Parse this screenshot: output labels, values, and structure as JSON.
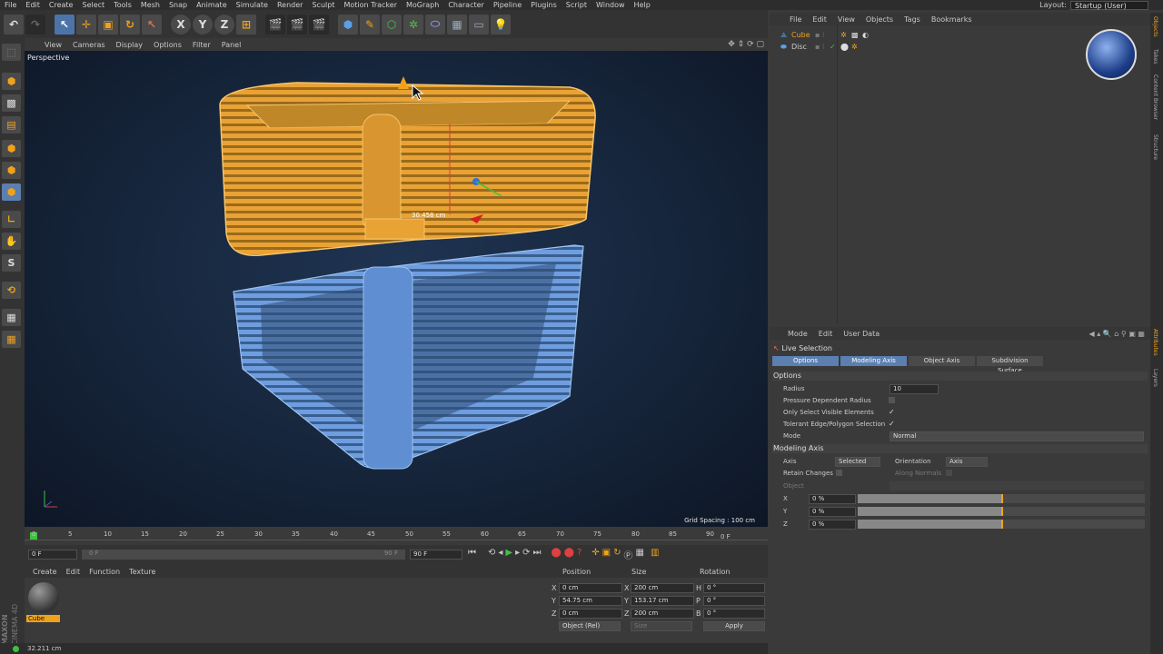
{
  "menubar": {
    "items": [
      "File",
      "Edit",
      "Create",
      "Select",
      "Tools",
      "Mesh",
      "Snap",
      "Animate",
      "Simulate",
      "Render",
      "Sculpt",
      "Motion Tracker",
      "MoGraph",
      "Character",
      "Pipeline",
      "Plugins",
      "Script",
      "Window",
      "Help"
    ],
    "layout_label": "Layout:",
    "layout_value": "Startup (User)"
  },
  "viewport": {
    "menu": [
      "View",
      "Cameras",
      "Display",
      "Options",
      "Filter",
      "Panel"
    ],
    "label": "Perspective",
    "grid_spacing": "Grid Spacing : 100 cm",
    "measure": "30.458 cm"
  },
  "timeline": {
    "ticks": [
      "0",
      "5",
      "10",
      "15",
      "20",
      "25",
      "30",
      "35",
      "40",
      "45",
      "50",
      "55",
      "60",
      "65",
      "70",
      "75",
      "80",
      "85",
      "90"
    ],
    "end_label": "0 F",
    "start_field": "0 F",
    "range_start": "0 F",
    "range_end": "90 F",
    "end_field": "90 F"
  },
  "material": {
    "menu": [
      "Create",
      "Edit",
      "Function",
      "Texture"
    ],
    "name": "Cube"
  },
  "coords": {
    "headers": [
      "Position",
      "Size",
      "Rotation"
    ],
    "rows": [
      {
        "axis": "X",
        "pos": "0 cm",
        "size_axis": "X",
        "size": "200 cm",
        "rot_axis": "H",
        "rot": "0 °"
      },
      {
        "axis": "Y",
        "pos": "54.75 cm",
        "size_axis": "Y",
        "size": "153.17 cm",
        "rot_axis": "P",
        "rot": "0 °"
      },
      {
        "axis": "Z",
        "pos": "0 cm",
        "size_axis": "Z",
        "size": "200 cm",
        "rot_axis": "B",
        "rot": "0 °"
      }
    ],
    "mode": "Object (Rel)",
    "size_mode": "Size",
    "apply": "Apply"
  },
  "status": "32.211 cm",
  "objects": {
    "menu": [
      "File",
      "Edit",
      "View",
      "Objects",
      "Tags",
      "Bookmarks"
    ],
    "items": [
      {
        "name": "Cube",
        "selected": true
      },
      {
        "name": "Disc",
        "selected": false
      }
    ]
  },
  "attributes": {
    "menu": [
      "Mode",
      "Edit",
      "User Data"
    ],
    "tool": "Live Selection",
    "tabs": [
      "Options",
      "Modeling Axis",
      "Object Axis",
      "Subdivision Surface"
    ],
    "options_title": "Options",
    "radius_label": "Radius",
    "radius_value": "10",
    "pressure": "Pressure Dependent Radius",
    "visible": "Only Select Visible Elements",
    "tolerant": "Tolerant Edge/Polygon Selection",
    "check": "✓",
    "mode_label": "Mode",
    "mode_value": "Normal",
    "axis_title": "Modeling Axis",
    "axis_label": "Axis",
    "axis_value": "Selected",
    "orient_label": "Orientation",
    "orient_value": "Axis",
    "retain": "Retain Changes",
    "along": "Along Normals",
    "object": "Object",
    "xyz": [
      {
        "label": "X",
        "value": "0 %"
      },
      {
        "label": "Y",
        "value": "0 %"
      },
      {
        "label": "Z",
        "value": "0 %"
      }
    ]
  },
  "sidetabs": [
    "Objects",
    "Takes",
    "Content Browser",
    "Structure",
    "Attributes",
    "Layers"
  ],
  "brand": [
    "MAXON",
    "CINEMA 4D"
  ],
  "colors": {
    "accent": "#5b7fb0",
    "selection": "#f1a21a",
    "wire_blue": "#6f9ee0"
  }
}
